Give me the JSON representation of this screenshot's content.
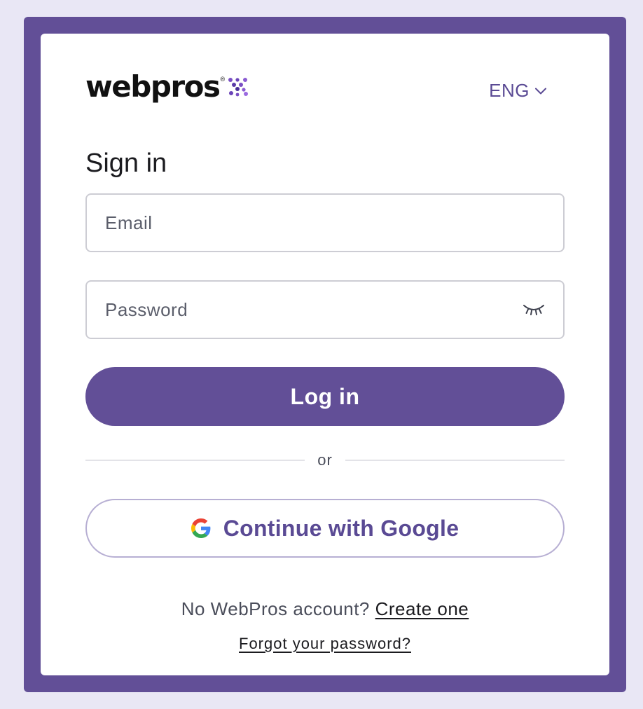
{
  "brand": {
    "logo_text": "webpros",
    "logo_reg": "®",
    "logo_mark_icon": "webpros-dots-icon",
    "accent": "#624f97",
    "accent_text": "#5a4a94"
  },
  "language": {
    "selected": "ENG",
    "icon": "chevron-down-icon"
  },
  "form": {
    "title": "Sign in",
    "email_placeholder": "Email",
    "email_value": "",
    "password_placeholder": "Password",
    "password_value": "",
    "password_toggle_icon": "eye-closed-icon",
    "login_label": "Log in",
    "divider_text": "or",
    "google_label": "Continue with Google",
    "google_icon": "google-g-icon"
  },
  "footer": {
    "no_account_text": "No WebPros account?",
    "create_link": "Create one",
    "forgot_link": "Forgot your password?"
  }
}
